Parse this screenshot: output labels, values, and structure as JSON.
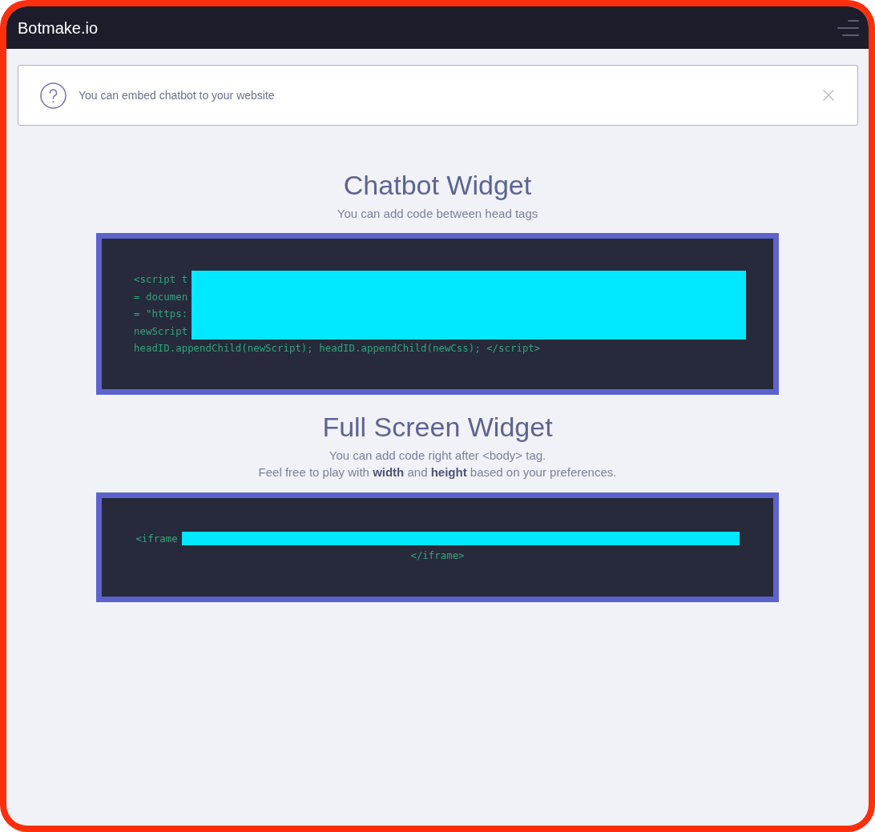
{
  "header": {
    "brand": "Botmake.io"
  },
  "alert": {
    "message": "You can embed chatbot to your website"
  },
  "sections": [
    {
      "title": "Chatbot Widget",
      "subtitle": [
        "You can add code between head tags"
      ],
      "code": {
        "kind": "left",
        "lines": [
          {
            "text": "<script t",
            "redacted": true
          },
          {
            "text": "= documen",
            "redacted": true
          },
          {
            "text": "= \"https:",
            "redacted": true
          },
          {
            "text": "newScript",
            "redacted": true
          },
          {
            "text": "headID.appendChild(newScript); headID.appendChild(newCss); </script>",
            "redacted": false
          }
        ]
      }
    },
    {
      "title": "Full Screen Widget",
      "subtitle": [
        "You can add code right after <body> tag.",
        "Feel free to play with **width** and **height** based on your preferences."
      ],
      "code": {
        "kind": "centered",
        "lines": [
          {
            "text": "<iframe",
            "redacted": true
          },
          {
            "text": "</iframe>",
            "redacted": false
          }
        ]
      }
    }
  ]
}
